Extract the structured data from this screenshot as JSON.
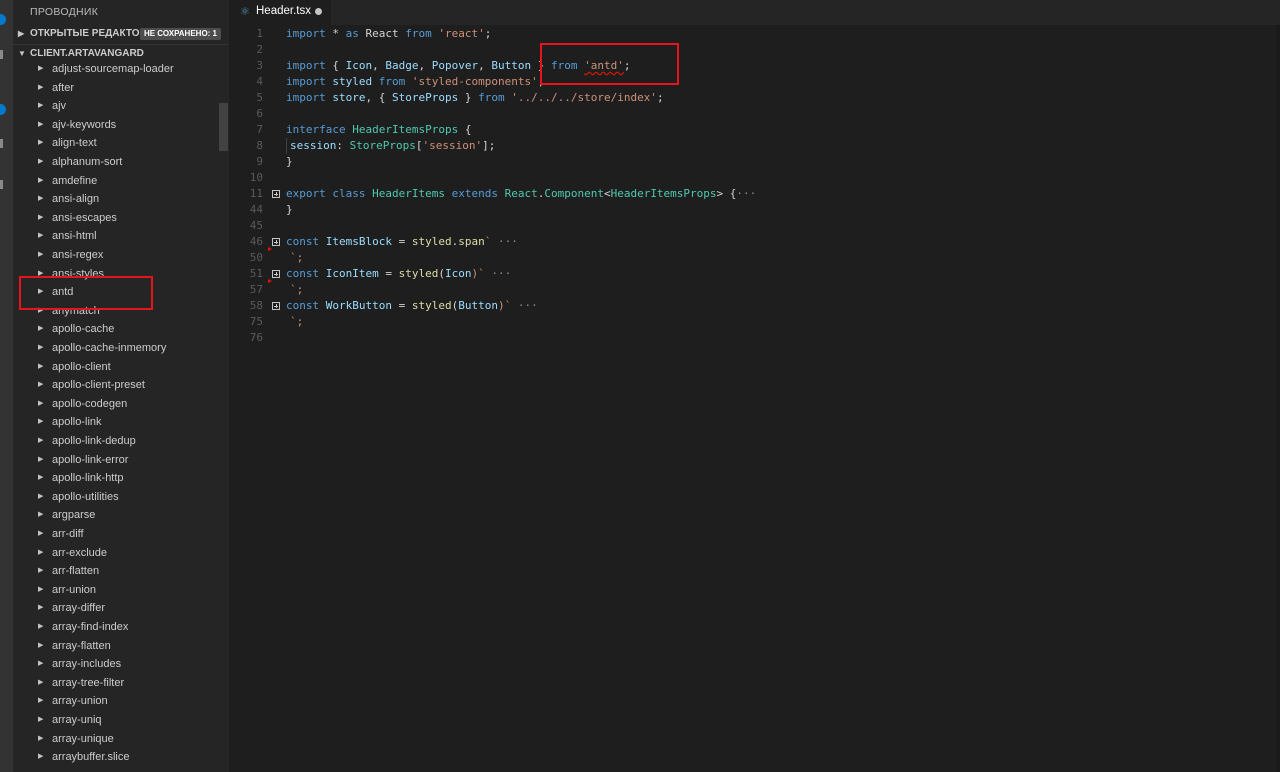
{
  "sidebar": {
    "title": "ПРОВОДНИК",
    "open_editors": {
      "label": "ОТКРЫТЫЕ РЕДАКТОРЫ",
      "badge": "НЕ СОХРАНЕНО: 1"
    },
    "project": {
      "label": "CLIENT.ARTAVANGARD"
    },
    "items": [
      "adjust-sourcemap-loader",
      "after",
      "ajv",
      "ajv-keywords",
      "align-text",
      "alphanum-sort",
      "amdefine",
      "ansi-align",
      "ansi-escapes",
      "ansi-html",
      "ansi-regex",
      "ansi-styles",
      "antd",
      "anymatch",
      "apollo-cache",
      "apollo-cache-inmemory",
      "apollo-client",
      "apollo-client-preset",
      "apollo-codegen",
      "apollo-link",
      "apollo-link-dedup",
      "apollo-link-error",
      "apollo-link-http",
      "apollo-utilities",
      "argparse",
      "arr-diff",
      "arr-exclude",
      "arr-flatten",
      "arr-union",
      "array-differ",
      "array-find-index",
      "array-flatten",
      "array-includes",
      "array-tree-filter",
      "array-union",
      "array-uniq",
      "array-unique",
      "arraybuffer.slice"
    ]
  },
  "editor": {
    "tab": {
      "icon": "react-icon",
      "label": "Header.tsx",
      "dirty": true
    },
    "line_numbers": [
      "1",
      "2",
      "3",
      "4",
      "5",
      "6",
      "7",
      "8",
      "9",
      "10",
      "11",
      "44",
      "45",
      "46",
      "50",
      "51",
      "57",
      "58",
      "75",
      "76"
    ],
    "code": {
      "l1": [
        "import",
        " * ",
        "as",
        " React ",
        "from",
        " ",
        "'react'",
        ";"
      ],
      "l3": [
        "import",
        " { ",
        "Icon",
        ", ",
        "Badge",
        ", ",
        "Popover",
        ", ",
        "Button",
        " } ",
        "from",
        " ",
        "'antd'",
        ";"
      ],
      "l4": [
        "import",
        " ",
        "styled",
        " ",
        "from",
        " ",
        "'styled-components'",
        ";"
      ],
      "l5": [
        "import",
        " ",
        "store",
        ", { ",
        "StoreProps",
        " } ",
        "from",
        " ",
        "'../../../store/index'",
        ";"
      ],
      "l7": [
        "interface",
        " ",
        "HeaderItemsProps",
        " {"
      ],
      "l8": [
        "session",
        ": ",
        "StoreProps",
        "[",
        "'session'",
        "];"
      ],
      "l9": [
        "}"
      ],
      "l11": [
        "export",
        " ",
        "class",
        " ",
        "HeaderItems",
        " ",
        "extends",
        " ",
        "React",
        ".",
        "Component",
        "<",
        "HeaderItemsProps",
        "> ",
        "{",
        "···"
      ],
      "l44": [
        "}"
      ],
      "l46": [
        "const",
        " ",
        "ItemsBlock",
        " = ",
        "styled",
        ".",
        "span",
        "`",
        " ···"
      ],
      "l50": [
        "`;"
      ],
      "l51": [
        "const",
        " ",
        "IconItem",
        " = ",
        "styled",
        "(",
        "Icon",
        ")`",
        " ···"
      ],
      "l57": [
        "`;"
      ],
      "l58": [
        "const",
        " ",
        "WorkButton",
        " = ",
        "styled",
        "(",
        "Button",
        ")`",
        " ···"
      ],
      "l75": [
        "`;"
      ]
    }
  },
  "colors": {
    "annotation": "#e8141c",
    "accent": "#007acc",
    "keyword": "#569cd6",
    "string": "#ce9178",
    "type": "#4ec9b0"
  }
}
